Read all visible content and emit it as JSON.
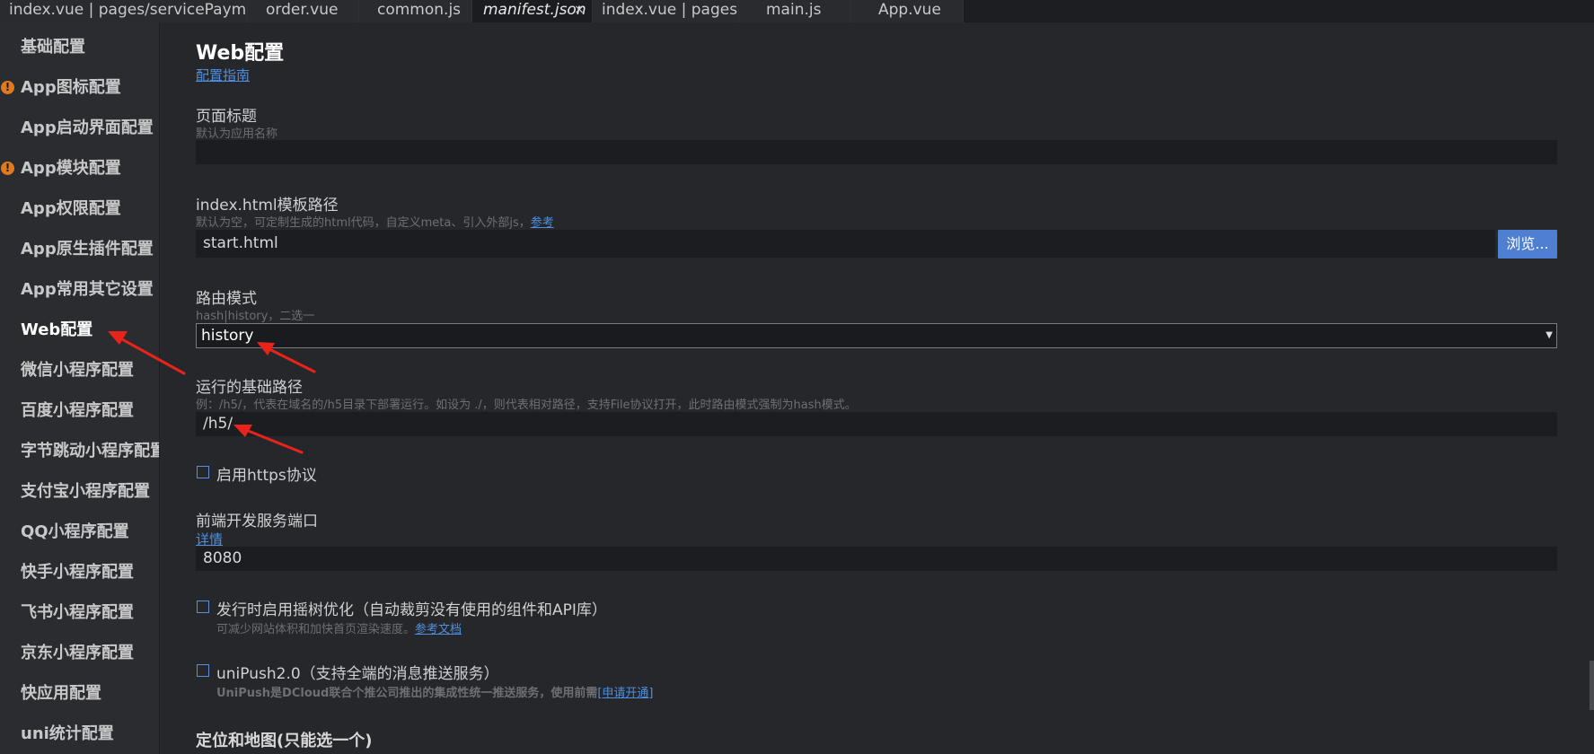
{
  "tabs": [
    {
      "label": "index.vue | pages/servicePayment",
      "active": false
    },
    {
      "label": "order.vue",
      "active": false
    },
    {
      "label": "common.js",
      "active": false
    },
    {
      "label": "manifest.json",
      "active": true,
      "close": "×"
    },
    {
      "label": "index.vue | pages",
      "active": false
    },
    {
      "label": "main.js",
      "active": false
    },
    {
      "label": "App.vue",
      "active": false
    }
  ],
  "sidebar": {
    "items": [
      {
        "label": "基础配置",
        "warning": false
      },
      {
        "label": "App图标配置",
        "warning": true
      },
      {
        "label": "App启动界面配置",
        "warning": false
      },
      {
        "label": "App模块配置",
        "warning": true
      },
      {
        "label": "App权限配置",
        "warning": false
      },
      {
        "label": "App原生插件配置",
        "warning": false
      },
      {
        "label": "App常用其它设置",
        "warning": false
      },
      {
        "label": "Web配置",
        "warning": false,
        "active": true
      },
      {
        "label": "微信小程序配置",
        "warning": false
      },
      {
        "label": "百度小程序配置",
        "warning": false
      },
      {
        "label": "字节跳动小程序配置",
        "warning": false
      },
      {
        "label": "支付宝小程序配置",
        "warning": false
      },
      {
        "label": "QQ小程序配置",
        "warning": false
      },
      {
        "label": "快手小程序配置",
        "warning": false
      },
      {
        "label": "飞书小程序配置",
        "warning": false
      },
      {
        "label": "京东小程序配置",
        "warning": false
      },
      {
        "label": "快应用配置",
        "warning": false
      },
      {
        "label": "uni统计配置",
        "warning": false
      }
    ],
    "warning_glyph": "!"
  },
  "main": {
    "title": "Web配置",
    "guide_link": "配置指南",
    "page_title": {
      "label": "页面标题",
      "hint": "默认为应用名称",
      "value": ""
    },
    "template": {
      "label": "index.html模板路径",
      "hint": "默认为空，可定制生成的html代码，自定义meta、引入外部js，",
      "hint_link": "参考",
      "value": "start.html",
      "browse_button": "浏览..."
    },
    "router": {
      "label": "路由模式",
      "hint": "hash|history，二选一",
      "value": "history",
      "caret": "▼"
    },
    "base_path": {
      "label": "运行的基础路径",
      "hint": "例：/h5/，代表在域名的/h5目录下部署运行。如设为 ./，则代表相对路径，支持File协议打开，此时路由模式强制为hash模式。",
      "value": "/h5/"
    },
    "https": {
      "label": "启用https协议",
      "checked": false
    },
    "dev_port": {
      "label": "前端开发服务端口",
      "link": "详情",
      "value": "8080"
    },
    "treeshake": {
      "label": "发行时启用摇树优化（自动裁剪没有使用的组件和API库）",
      "hint": "可减少网站体积和加快首页渲染速度。",
      "hint_link": "参考文档",
      "checked": false
    },
    "unipush": {
      "label": "uniPush2.0（支持全端的消息推送服务）",
      "hint": "UniPush是DCloud联合个推公司推出的集成性统一推送服务，使用前需",
      "hint_link": "[申请开通]",
      "checked": false
    },
    "location_section": "定位和地图(只能选一个)"
  },
  "colors": {
    "accent": "#4f7fd0",
    "link": "#4d8fe0",
    "warning": "#e07a1f",
    "annotation": "#e8231c"
  }
}
